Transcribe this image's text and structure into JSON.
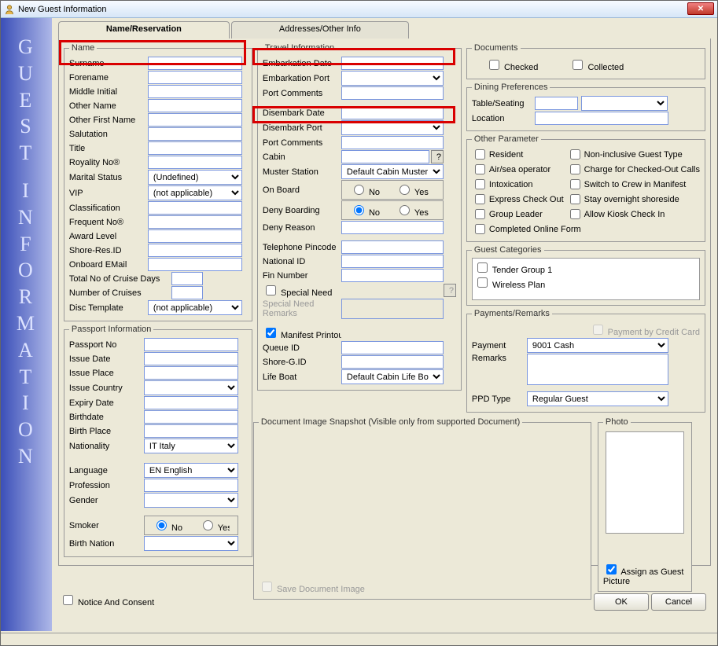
{
  "window": {
    "title": "New Guest Information"
  },
  "sidebar": {
    "text": "GUEST INFORMATION"
  },
  "tabs": {
    "tab1": "Name/Reservation",
    "tab2": "Addresses/Other Info"
  },
  "name_group": {
    "legend": "Name",
    "surname": "Surname",
    "forename": "Forename",
    "middle_initial": "Middle Initial",
    "other_name": "Other Name",
    "other_first_name": "Other First Name",
    "salutation": "Salutation",
    "title": "Title",
    "royality_no": "Royality No®",
    "marital_status": "Marital Status",
    "marital_status_val": "(Undefined)",
    "vip": "VIP",
    "vip_val": "(not applicable)",
    "classification": "Classification",
    "frequent_no": "Frequent No®",
    "award_level": "Award Level",
    "shore_res_id": "Shore-Res.ID",
    "onboard_email": "Onboard EMail",
    "total_cruise_days": "Total No of Cruise Days",
    "number_cruises": "Number of Cruises",
    "disc_template": "Disc Template",
    "disc_template_val": "(not applicable)"
  },
  "passport_group": {
    "legend": "Passport Information",
    "passport_no": "Passport No",
    "issue_date": "Issue Date",
    "issue_place": "Issue Place",
    "issue_country": "Issue Country",
    "expiry_date": "Expiry Date",
    "birthdate": "Birthdate",
    "birth_place": "Birth Place",
    "nationality": "Nationality",
    "nationality_val": "IT Italy",
    "language": "Language",
    "language_val": "EN English",
    "profession": "Profession",
    "gender": "Gender",
    "smoker": "Smoker",
    "no": "No",
    "yes": "Yes",
    "birth_nation": "Birth Nation"
  },
  "travel_group": {
    "legend": "Travel Information",
    "embarkation_date": "Embarkation Date",
    "embarkation_port": "Embarkation Port",
    "port_comments": "Port Comments",
    "disembark_date": "Disembark Date",
    "disembark_port": "Disembark Port",
    "port_comments2": "Port Comments",
    "cabin": "Cabin",
    "cabin_help": "?",
    "muster_station": "Muster Station",
    "muster_station_val": "Default Cabin Muster Station",
    "on_board": "On Board",
    "deny_boarding": "Deny Boarding",
    "deny_reason": "Deny Reason",
    "telephone_pincode": "Telephone Pincode",
    "national_id": "National ID",
    "fin_number": "Fin Number",
    "special_need": "Special Need",
    "special_need_help": "?",
    "special_need_remarks": "Special Need\nRemarks",
    "manifest_printout": "Manifest Printout",
    "queue_id": "Queue ID",
    "shore_g_id": "Shore-G.ID",
    "life_boat": "Life Boat",
    "life_boat_val": "Default Cabin Life Boat",
    "no": "No",
    "yes": "Yes"
  },
  "documents_group": {
    "legend": "Documents",
    "checked": "Checked",
    "collected": "Collected"
  },
  "dining_group": {
    "legend": "Dining Preferences",
    "table_seating": "Table/Seating",
    "location": "Location"
  },
  "other_param_group": {
    "legend": "Other Parameter",
    "resident": "Resident",
    "air_sea": "Air/sea operator",
    "intoxication": "Intoxication",
    "express_checkout": "Express Check Out",
    "group_leader": "Group Leader",
    "completed_online": "Completed Online Form",
    "non_inclusive": "Non-inclusive Guest Type",
    "charge_checkout": "Charge for Checked-Out Calls",
    "switch_crew": "Switch to Crew in Manifest",
    "stay_overnight": "Stay overnight shoreside",
    "allow_kiosk": "Allow Kiosk Check In"
  },
  "guest_cat_group": {
    "legend": "Guest Categories",
    "tender": "Tender Group 1",
    "wireless": "Wireless Plan"
  },
  "payments_group": {
    "legend": "Payments/Remarks",
    "payment_cc": "Payment by Credit Card",
    "payment": "Payment",
    "payment_val": "9001 Cash",
    "remarks": "Remarks",
    "ppd_type": "PPD Type",
    "ppd_type_val": "Regular Guest"
  },
  "snapshot": {
    "legend": "Document Image Snapshot (Visible only from supported Document)",
    "save": "Save Document Image"
  },
  "photo": {
    "legend": "Photo",
    "assign": "Assign as Guest Picture"
  },
  "notice": "Notice And Consent",
  "buttons": {
    "ok": "OK",
    "cancel": "Cancel"
  }
}
